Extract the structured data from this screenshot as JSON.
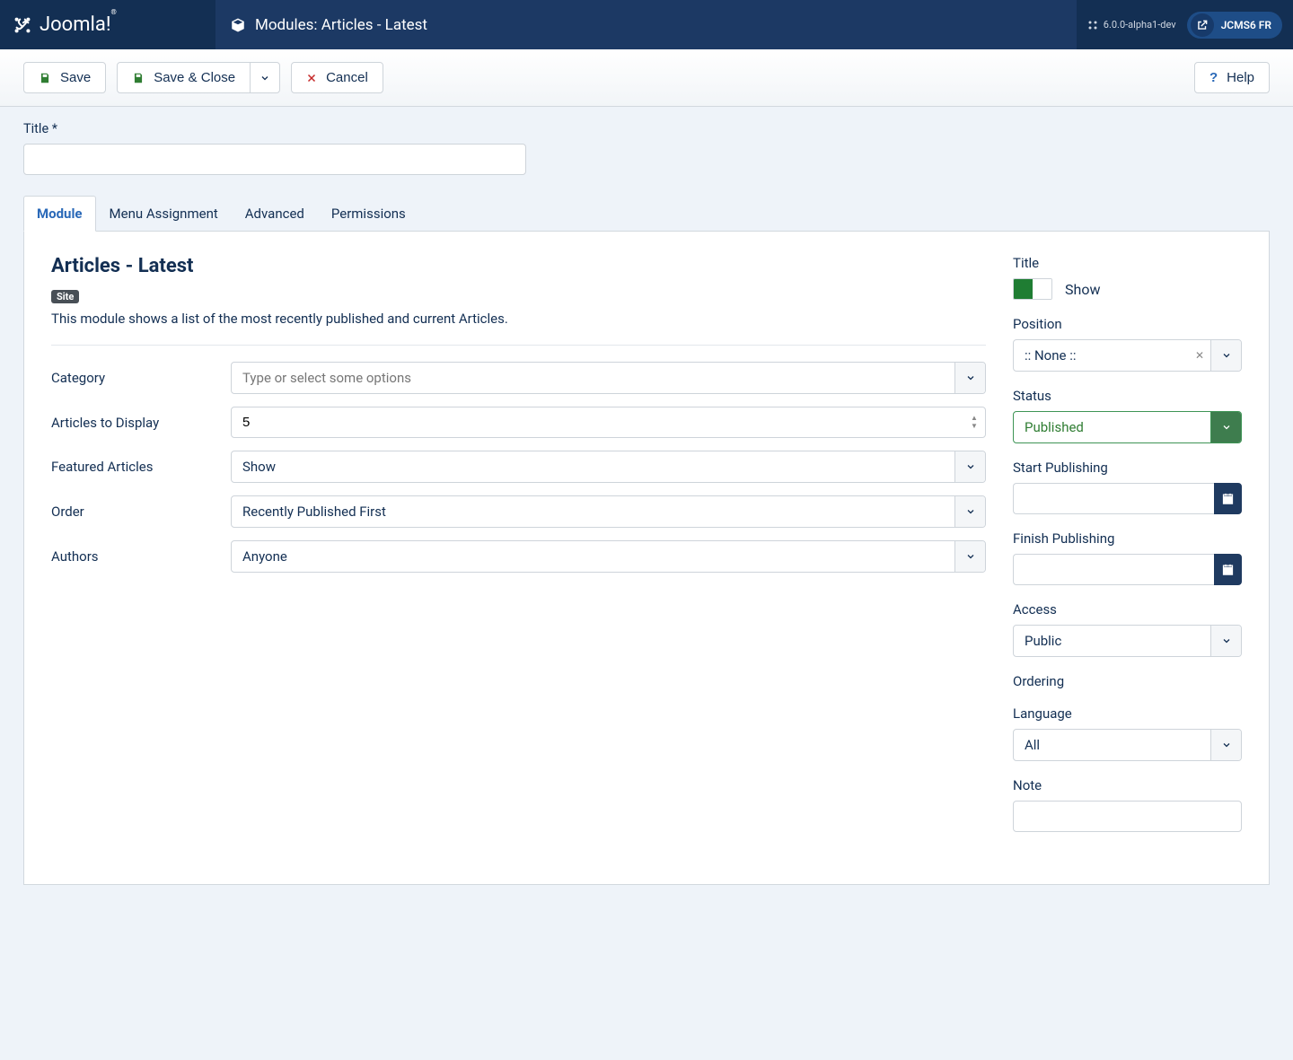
{
  "brand": "Joomla!",
  "page_title": "Modules: Articles - Latest",
  "version": "6.0.0-alpha1-dev",
  "site_name": "JCMS6 FR",
  "toolbar": {
    "save": "Save",
    "save_close": "Save & Close",
    "cancel": "Cancel",
    "help": "Help"
  },
  "title_field": {
    "label": "Title *",
    "value": ""
  },
  "tabs": [
    "Module",
    "Menu Assignment",
    "Advanced",
    "Permissions"
  ],
  "module": {
    "heading": "Articles - Latest",
    "badge": "Site",
    "desc": "This module shows a list of the most recently published and current Articles.",
    "fields": {
      "category": {
        "label": "Category",
        "placeholder": "Type or select some options"
      },
      "count": {
        "label": "Articles to Display",
        "value": "5"
      },
      "featured": {
        "label": "Featured Articles",
        "value": "Show"
      },
      "order": {
        "label": "Order",
        "value": "Recently Published First"
      },
      "authors": {
        "label": "Authors",
        "value": "Anyone"
      }
    }
  },
  "side": {
    "title": {
      "label": "Title",
      "value": "Show"
    },
    "position": {
      "label": "Position",
      "value": ":: None ::"
    },
    "status": {
      "label": "Status",
      "value": "Published"
    },
    "start": {
      "label": "Start Publishing",
      "value": ""
    },
    "finish": {
      "label": "Finish Publishing",
      "value": ""
    },
    "access": {
      "label": "Access",
      "value": "Public"
    },
    "ordering": {
      "label": "Ordering"
    },
    "language": {
      "label": "Language",
      "value": "All"
    },
    "note": {
      "label": "Note",
      "value": ""
    }
  }
}
